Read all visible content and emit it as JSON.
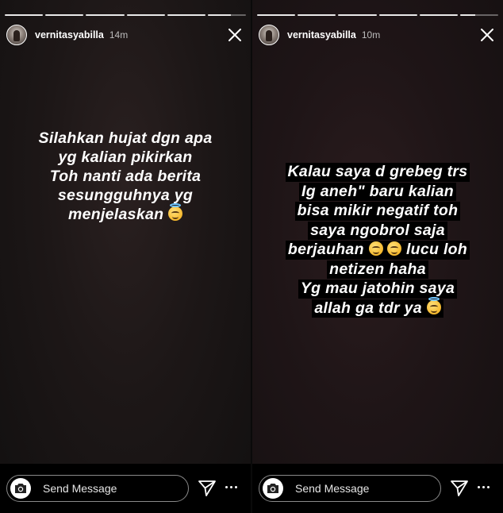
{
  "stories": [
    {
      "username": "vernitasyabilla",
      "time": "14m",
      "progress": [
        1,
        1,
        1,
        1,
        1,
        0.6
      ],
      "caption": [
        "Silahkan hujat dgn apa",
        "yg kalian pikirkan",
        "Toh nanti ada berita",
        "sesungguhnya yg",
        "menjelaskan"
      ],
      "reply_placeholder": "Send Message"
    },
    {
      "username": "vernitasyabilla",
      "time": "10m",
      "progress": [
        1,
        1,
        1,
        1,
        1,
        0.4
      ],
      "caption": [
        "Kalau saya d grebeg trs",
        "Ig aneh\" baru kalian",
        "bisa mikir negatif toh",
        "saya ngobrol saja",
        "berjauhan",
        "lucu loh",
        "netizen haha",
        "Yg mau jatohin saya",
        "allah ga tdr ya"
      ],
      "reply_placeholder": "Send Message"
    }
  ],
  "icons": {
    "close": "close-icon",
    "camera": "camera-icon",
    "send": "send-icon",
    "more": "more-icon",
    "emoji_halo": "smiling-face-with-halo",
    "emoji_laugh": "face-with-tears-of-joy",
    "emoji_rofl": "rolling-on-floor-laughing"
  },
  "colors": {
    "background": "#000000",
    "text": "#ffffff",
    "time": "#bdbdbd",
    "progress_track": "#595959",
    "progress_fill": "#e9e9e9"
  }
}
